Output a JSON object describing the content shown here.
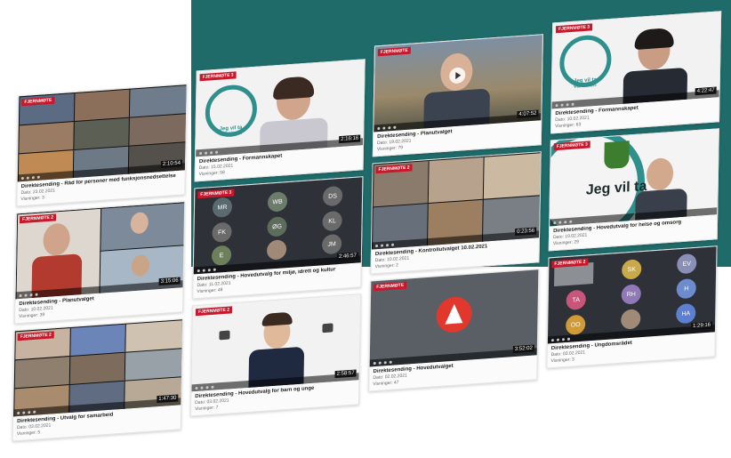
{
  "cards": [
    {
      "badge": "FJERNMØTE",
      "title": "Direktesending - Råd for personer med funksjonsnedsettelse",
      "date": "Dato: 23.02.2021",
      "views": "Visninger: 3",
      "duration": "2:10:54"
    },
    {
      "badge": "FJERNMØTE 3",
      "title": "Direktesending - Formannskapet",
      "date": "Dato: 15.02.2021",
      "views": "Visninger: 58",
      "duration": "2:16:16",
      "logo": "Jeg vil ta vaksinen"
    },
    {
      "badge": "FJERNMØTE",
      "title": "Direktesending - Planutvalget",
      "date": "Dato: 19.02.2021",
      "views": "Visninger: 79",
      "duration": "4:07:52"
    },
    {
      "badge": "FJERNMØTE 3",
      "title": "Direktesending - Formannskapet",
      "date": "Dato: 10.02.2021",
      "views": "Visninger: 63",
      "duration": "4:22:47",
      "logo": "Jeg vil ta vaksinen"
    },
    {
      "badge": "FJERNMØTE 2",
      "title": "Direktesending - Planutvalget",
      "date": "Dato: 10.02.2021",
      "views": "Visninger: 39",
      "duration": "3:15:06"
    },
    {
      "badge": "FJERNMØTE 3",
      "title": "Direktesending - Hovedutvalg for miljø, idrett og kultur",
      "date": "Dato: 11.02.2021",
      "views": "Visninger: 48",
      "duration": "2:46:57",
      "initials": [
        "MR",
        "WB",
        "DS",
        "FK",
        "ØG",
        "KL",
        "E",
        "",
        "JM"
      ]
    },
    {
      "badge": "FJERNMØTE 2",
      "title": "Direktesending - Kontrollutvalget 10.02.2021",
      "date": "Dato: 10.02.2021",
      "views": "Visninger: 2",
      "duration": "0:23:56"
    },
    {
      "badge": "FJERNMØTE 3",
      "title": "Direktesending - Hovedutvalg for helse og omsorg",
      "date": "Dato: 10.02.2021",
      "views": "Visninger: 29",
      "duration": "",
      "logo": "Jeg vil ta"
    },
    {
      "badge": "FJERNMØTE 2",
      "title": "Direktesending - Utvalg for samarbeid",
      "date": "Dato: 03.02.2021",
      "views": "Visninger: 5",
      "duration": "1:47:30"
    },
    {
      "badge": "FJERNMØTE 2",
      "title": "Direktesending - Hovedutvalg for barn og unge",
      "date": "Dato: 03.02.2021",
      "views": "Visninger: 7",
      "duration": "2:58:57"
    },
    {
      "badge": "FJERNMØTE",
      "title": "Direktesending - Hovedutvalget",
      "date": "Dato: 02.02.2021",
      "views": "Visninger: 47",
      "duration": "3:52:02"
    },
    {
      "badge": "FJERNMØTE 2",
      "title": "Direktesending - Ungdomsrådet",
      "date": "Dato: 03.02.2021",
      "views": "Visninger: 3",
      "duration": "1:29:16",
      "initials": [
        "",
        "SK",
        "EV",
        "TA",
        "RH",
        "H",
        "OO",
        "",
        "HA"
      ]
    }
  ],
  "colors": {
    "badge": "#c9182b",
    "teal": "#1f6b6a",
    "logo": "#2f8f8c"
  }
}
